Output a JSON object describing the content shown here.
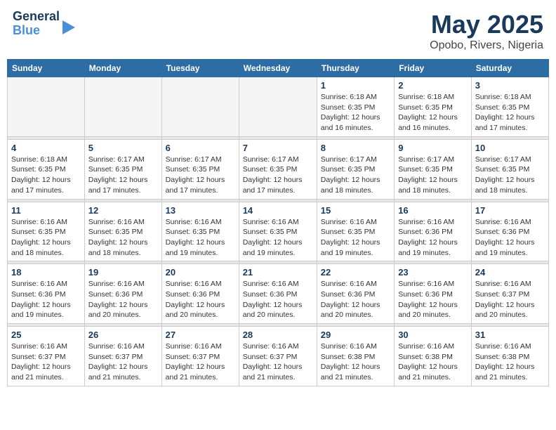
{
  "header": {
    "logo_line1": "General",
    "logo_line2": "Blue",
    "month": "May 2025",
    "location": "Opobo, Rivers, Nigeria"
  },
  "weekdays": [
    "Sunday",
    "Monday",
    "Tuesday",
    "Wednesday",
    "Thursday",
    "Friday",
    "Saturday"
  ],
  "weeks": [
    [
      {
        "day": "",
        "info": ""
      },
      {
        "day": "",
        "info": ""
      },
      {
        "day": "",
        "info": ""
      },
      {
        "day": "",
        "info": ""
      },
      {
        "day": "1",
        "info": "Sunrise: 6:18 AM\nSunset: 6:35 PM\nDaylight: 12 hours\nand 16 minutes."
      },
      {
        "day": "2",
        "info": "Sunrise: 6:18 AM\nSunset: 6:35 PM\nDaylight: 12 hours\nand 16 minutes."
      },
      {
        "day": "3",
        "info": "Sunrise: 6:18 AM\nSunset: 6:35 PM\nDaylight: 12 hours\nand 17 minutes."
      }
    ],
    [
      {
        "day": "4",
        "info": "Sunrise: 6:18 AM\nSunset: 6:35 PM\nDaylight: 12 hours\nand 17 minutes."
      },
      {
        "day": "5",
        "info": "Sunrise: 6:17 AM\nSunset: 6:35 PM\nDaylight: 12 hours\nand 17 minutes."
      },
      {
        "day": "6",
        "info": "Sunrise: 6:17 AM\nSunset: 6:35 PM\nDaylight: 12 hours\nand 17 minutes."
      },
      {
        "day": "7",
        "info": "Sunrise: 6:17 AM\nSunset: 6:35 PM\nDaylight: 12 hours\nand 17 minutes."
      },
      {
        "day": "8",
        "info": "Sunrise: 6:17 AM\nSunset: 6:35 PM\nDaylight: 12 hours\nand 18 minutes."
      },
      {
        "day": "9",
        "info": "Sunrise: 6:17 AM\nSunset: 6:35 PM\nDaylight: 12 hours\nand 18 minutes."
      },
      {
        "day": "10",
        "info": "Sunrise: 6:17 AM\nSunset: 6:35 PM\nDaylight: 12 hours\nand 18 minutes."
      }
    ],
    [
      {
        "day": "11",
        "info": "Sunrise: 6:16 AM\nSunset: 6:35 PM\nDaylight: 12 hours\nand 18 minutes."
      },
      {
        "day": "12",
        "info": "Sunrise: 6:16 AM\nSunset: 6:35 PM\nDaylight: 12 hours\nand 18 minutes."
      },
      {
        "day": "13",
        "info": "Sunrise: 6:16 AM\nSunset: 6:35 PM\nDaylight: 12 hours\nand 19 minutes."
      },
      {
        "day": "14",
        "info": "Sunrise: 6:16 AM\nSunset: 6:35 PM\nDaylight: 12 hours\nand 19 minutes."
      },
      {
        "day": "15",
        "info": "Sunrise: 6:16 AM\nSunset: 6:35 PM\nDaylight: 12 hours\nand 19 minutes."
      },
      {
        "day": "16",
        "info": "Sunrise: 6:16 AM\nSunset: 6:36 PM\nDaylight: 12 hours\nand 19 minutes."
      },
      {
        "day": "17",
        "info": "Sunrise: 6:16 AM\nSunset: 6:36 PM\nDaylight: 12 hours\nand 19 minutes."
      }
    ],
    [
      {
        "day": "18",
        "info": "Sunrise: 6:16 AM\nSunset: 6:36 PM\nDaylight: 12 hours\nand 19 minutes."
      },
      {
        "day": "19",
        "info": "Sunrise: 6:16 AM\nSunset: 6:36 PM\nDaylight: 12 hours\nand 20 minutes."
      },
      {
        "day": "20",
        "info": "Sunrise: 6:16 AM\nSunset: 6:36 PM\nDaylight: 12 hours\nand 20 minutes."
      },
      {
        "day": "21",
        "info": "Sunrise: 6:16 AM\nSunset: 6:36 PM\nDaylight: 12 hours\nand 20 minutes."
      },
      {
        "day": "22",
        "info": "Sunrise: 6:16 AM\nSunset: 6:36 PM\nDaylight: 12 hours\nand 20 minutes."
      },
      {
        "day": "23",
        "info": "Sunrise: 6:16 AM\nSunset: 6:36 PM\nDaylight: 12 hours\nand 20 minutes."
      },
      {
        "day": "24",
        "info": "Sunrise: 6:16 AM\nSunset: 6:37 PM\nDaylight: 12 hours\nand 20 minutes."
      }
    ],
    [
      {
        "day": "25",
        "info": "Sunrise: 6:16 AM\nSunset: 6:37 PM\nDaylight: 12 hours\nand 21 minutes."
      },
      {
        "day": "26",
        "info": "Sunrise: 6:16 AM\nSunset: 6:37 PM\nDaylight: 12 hours\nand 21 minutes."
      },
      {
        "day": "27",
        "info": "Sunrise: 6:16 AM\nSunset: 6:37 PM\nDaylight: 12 hours\nand 21 minutes."
      },
      {
        "day": "28",
        "info": "Sunrise: 6:16 AM\nSunset: 6:37 PM\nDaylight: 12 hours\nand 21 minutes."
      },
      {
        "day": "29",
        "info": "Sunrise: 6:16 AM\nSunset: 6:38 PM\nDaylight: 12 hours\nand 21 minutes."
      },
      {
        "day": "30",
        "info": "Sunrise: 6:16 AM\nSunset: 6:38 PM\nDaylight: 12 hours\nand 21 minutes."
      },
      {
        "day": "31",
        "info": "Sunrise: 6:16 AM\nSunset: 6:38 PM\nDaylight: 12 hours\nand 21 minutes."
      }
    ]
  ]
}
